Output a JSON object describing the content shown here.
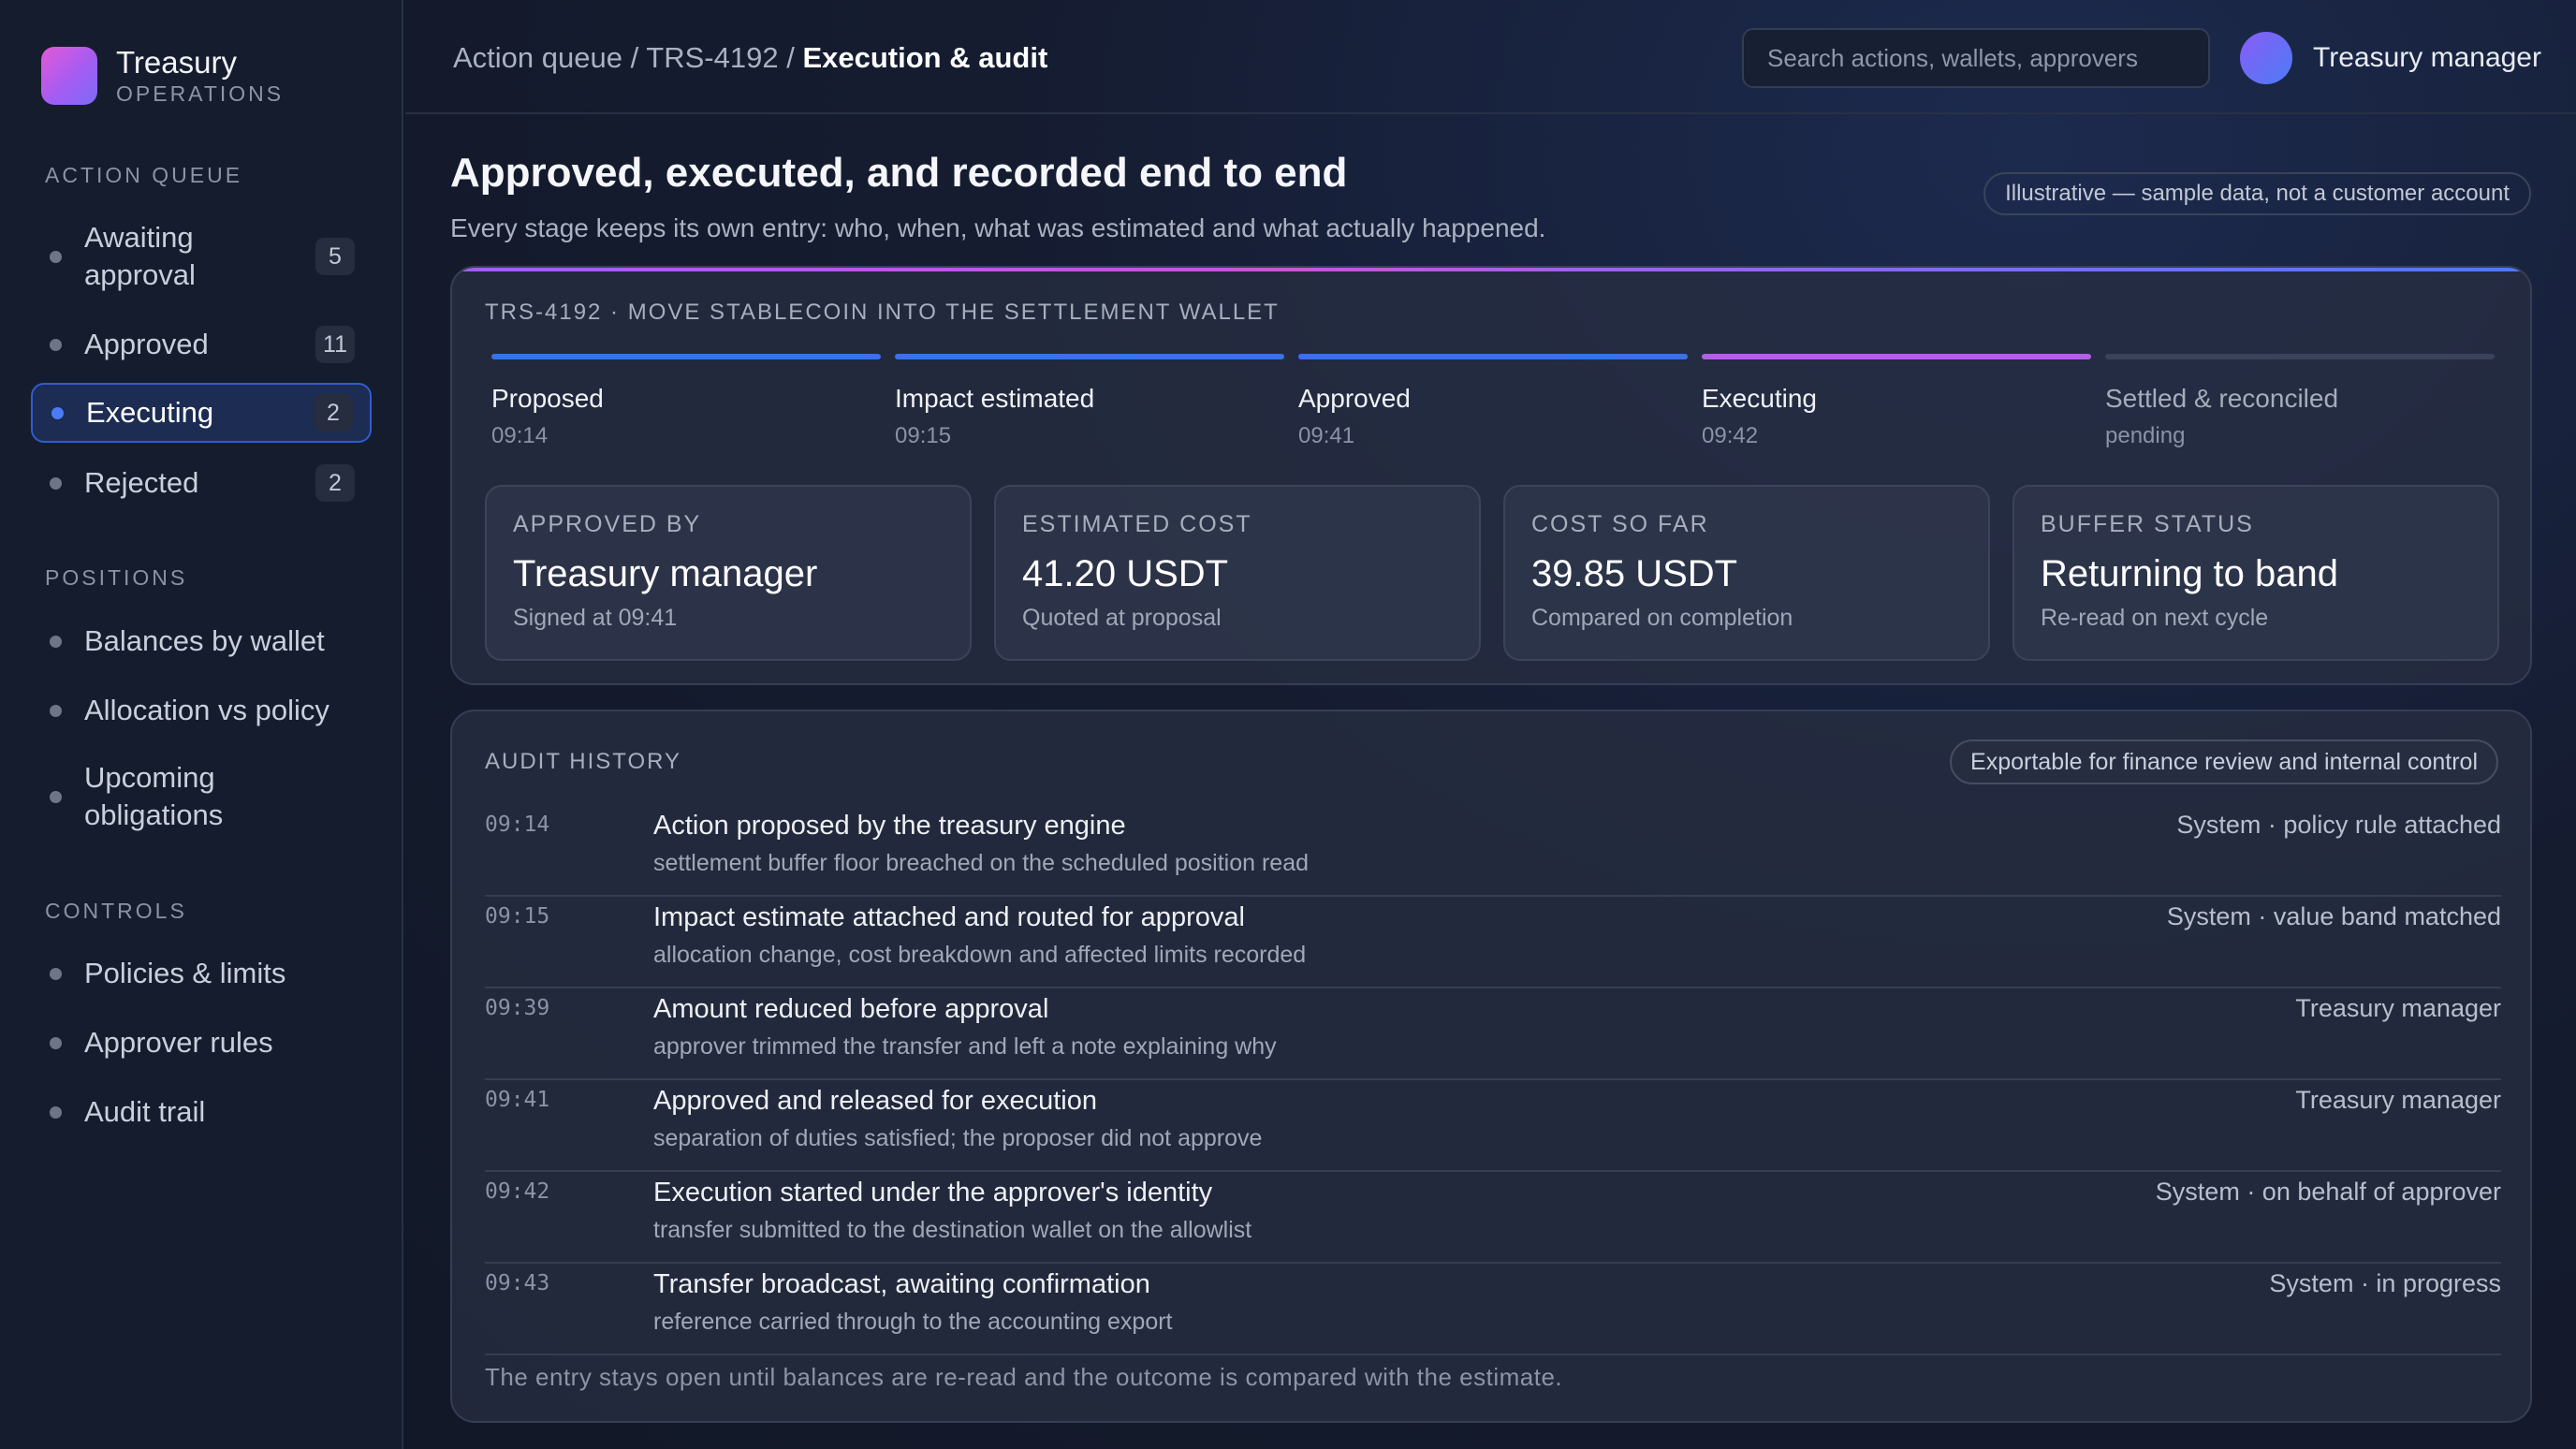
{
  "brand": {
    "name": "Treasury",
    "sub": "OPERATIONS",
    "logo_icon": "treasury-logo-icon"
  },
  "sidebar": {
    "sections": [
      {
        "title": "ACTION QUEUE",
        "items": [
          {
            "label": "Awaiting approval",
            "count": "5",
            "active": false
          },
          {
            "label": "Approved",
            "count": "11",
            "active": false
          },
          {
            "label": "Executing",
            "count": "2",
            "active": true
          },
          {
            "label": "Rejected",
            "count": "2",
            "active": false
          }
        ]
      },
      {
        "title": "POSITIONS",
        "items": [
          {
            "label": "Balances by wallet"
          },
          {
            "label": "Allocation vs policy"
          },
          {
            "label": "Upcoming obligations"
          }
        ]
      },
      {
        "title": "CONTROLS",
        "items": [
          {
            "label": "Policies & limits"
          },
          {
            "label": "Approver rules"
          },
          {
            "label": "Audit trail"
          }
        ]
      }
    ]
  },
  "topbar": {
    "breadcrumb": {
      "part1": "Action queue",
      "part2": "TRS-4192",
      "current": "Execution & audit",
      "separator": "/"
    },
    "search_placeholder": "Search actions, wallets, approvers",
    "user_name": "Treasury manager"
  },
  "page": {
    "title": "Approved, executed, and recorded end to end",
    "subtitle": "Every stage keeps its own entry: who, when, what was estimated and what actually happened.",
    "disclaimer": "Illustrative — sample data, not a customer account"
  },
  "action": {
    "kicker": "TRS-4192 · MOVE STABLECOIN INTO THE SETTLEMENT WALLET",
    "steps": [
      {
        "name": "Proposed",
        "time": "09:14",
        "state": "done"
      },
      {
        "name": "Impact estimated",
        "time": "09:15",
        "state": "done"
      },
      {
        "name": "Approved",
        "time": "09:41",
        "state": "done"
      },
      {
        "name": "Executing",
        "time": "09:42",
        "state": "active"
      },
      {
        "name": "Settled & reconciled",
        "time": "pending",
        "state": "pending"
      }
    ],
    "stats": [
      {
        "key": "APPROVED BY",
        "value": "Treasury manager",
        "sub": "Signed at 09:41"
      },
      {
        "key": "ESTIMATED COST",
        "value": "41.20 USDT",
        "sub": "Quoted at proposal"
      },
      {
        "key": "COST SO FAR",
        "value": "39.85 USDT",
        "sub": "Compared on completion"
      },
      {
        "key": "BUFFER STATUS",
        "value": "Returning to band",
        "sub": "Re-read on next cycle"
      }
    ]
  },
  "audit": {
    "title": "AUDIT HISTORY",
    "export_label": "Exportable for finance review and internal control",
    "rows": [
      {
        "time": "09:14",
        "title": "Action proposed by the treasury engine",
        "detail": "settlement buffer floor breached on the scheduled position read",
        "actor": "System · policy rule attached"
      },
      {
        "time": "09:15",
        "title": "Impact estimate attached and routed for approval",
        "detail": "allocation change, cost breakdown and affected limits recorded",
        "actor": "System · value band matched"
      },
      {
        "time": "09:39",
        "title": "Amount reduced before approval",
        "detail": "approver trimmed the transfer and left a note explaining why",
        "actor": "Treasury manager"
      },
      {
        "time": "09:41",
        "title": "Approved and released for execution",
        "detail": "separation of duties satisfied; the proposer did not approve",
        "actor": "Treasury manager"
      },
      {
        "time": "09:42",
        "title": "Execution started under the approver's identity",
        "detail": "transfer submitted to the destination wallet on the allowlist",
        "actor": "System · on behalf of approver"
      },
      {
        "time": "09:43",
        "title": "Transfer broadcast, awaiting confirmation",
        "detail": "reference carried through to the accounting export",
        "actor": "System · in progress"
      }
    ],
    "footer": "The entry stays open until balances are re-read and the outcome is compared with the estimate."
  },
  "colors": {
    "accent": "#3a72e6",
    "active_step": "#b062e6",
    "pending": "#3a4359"
  }
}
